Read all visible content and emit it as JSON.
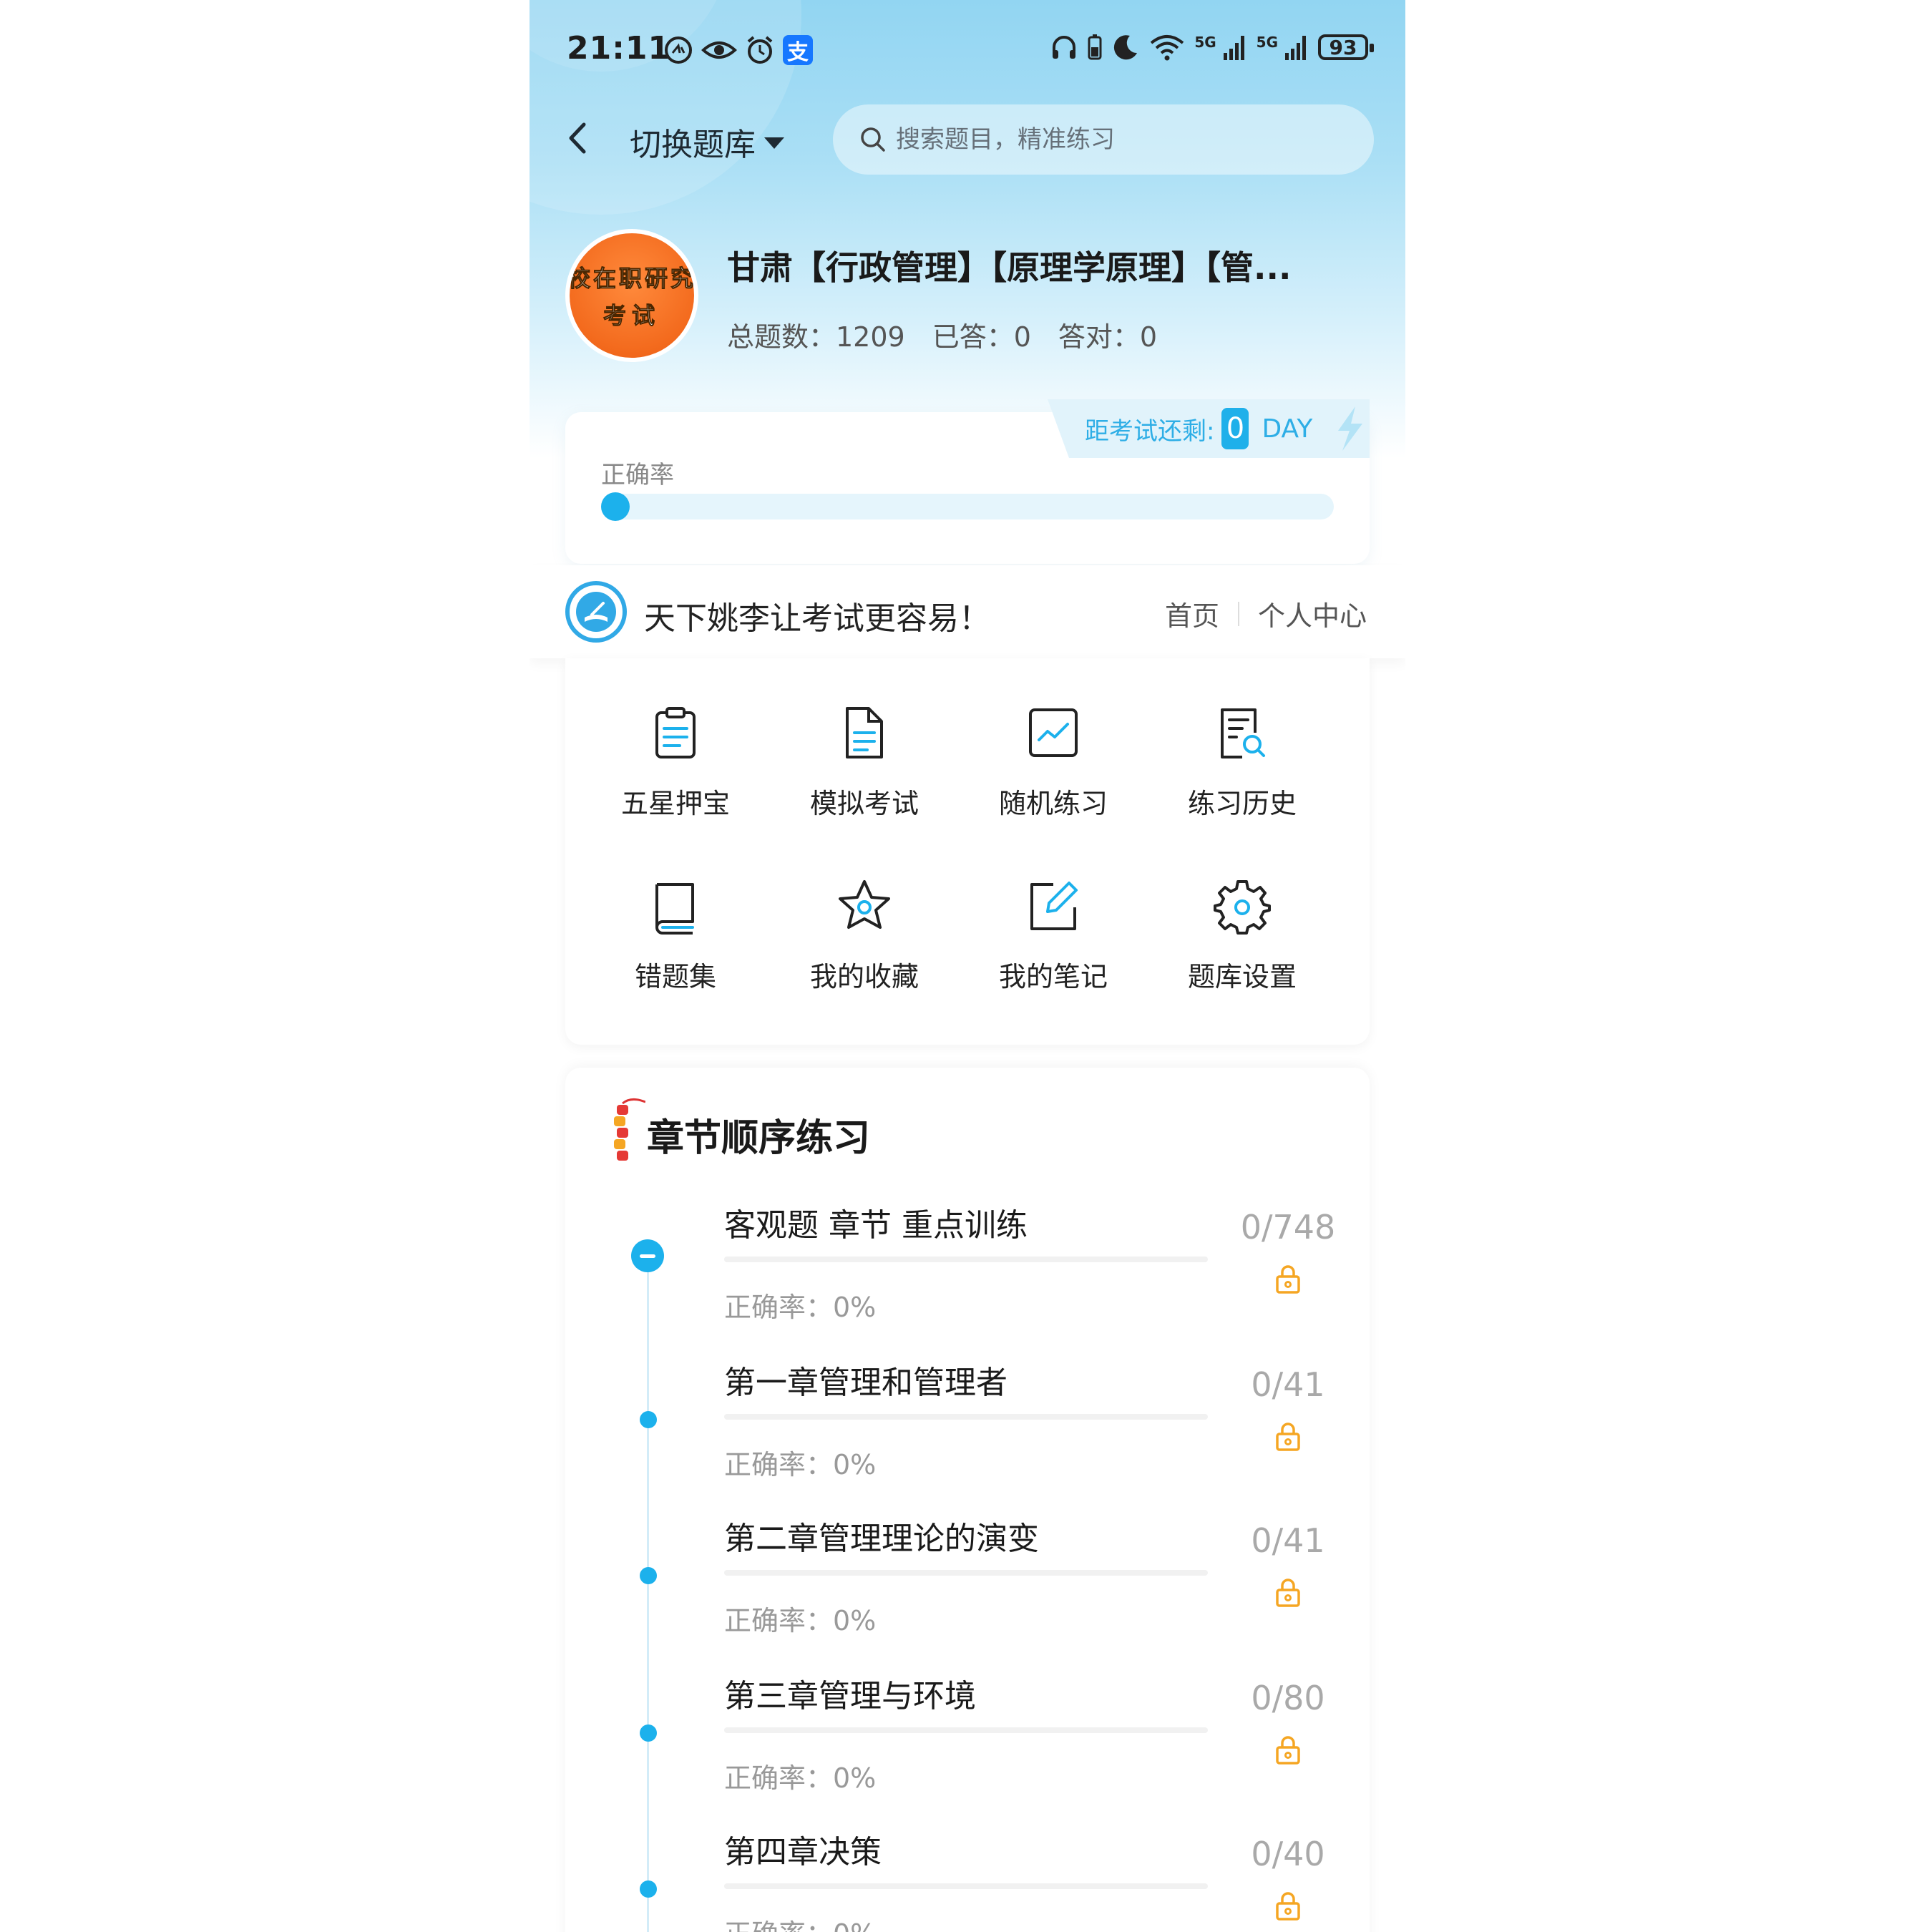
{
  "status_bar": {
    "time": "21:11",
    "battery": "93",
    "net_label": "5G"
  },
  "header": {
    "switch_label": "切换题库",
    "search_placeholder": "搜索题目，精准练习"
  },
  "bank": {
    "avatar_line1": "校在职研究",
    "avatar_line2": "考试",
    "title": "甘肃【行政管理】【原理学原理】【管...",
    "total_label": "总题数：1209",
    "answered_label": "已答：0",
    "correct_label": "答对：0"
  },
  "accuracy": {
    "label": "正确率",
    "value_percent": 0,
    "countdown_label": "距考试还剩:",
    "countdown_days": "0",
    "countdown_unit": "DAY"
  },
  "slogan": {
    "text": "天下姚李让考试更容易！",
    "link_home": "首页",
    "link_profile": "个人中心"
  },
  "menu": [
    {
      "label": "五星押宝",
      "icon": "clipboard-icon"
    },
    {
      "label": "模拟考试",
      "icon": "document-icon"
    },
    {
      "label": "随机练习",
      "icon": "chart-line-icon"
    },
    {
      "label": "练习历史",
      "icon": "history-search-icon"
    },
    {
      "label": "错题集",
      "icon": "book-icon"
    },
    {
      "label": "我的收藏",
      "icon": "star-icon"
    },
    {
      "label": "我的笔记",
      "icon": "edit-note-icon"
    },
    {
      "label": "题库设置",
      "icon": "gear-icon"
    }
  ],
  "chapters": {
    "title": "章节顺序练习",
    "items": [
      {
        "name": "客观题 章节 重点训练",
        "accuracy": "正确率：0%",
        "count": "0/748"
      },
      {
        "name": "第一章管理和管理者",
        "accuracy": "正确率：0%",
        "count": "0/41"
      },
      {
        "name": "第二章管理理论的演变",
        "accuracy": "正确率：0%",
        "count": "0/41"
      },
      {
        "name": "第三章管理与环境",
        "accuracy": "正确率：0%",
        "count": "0/80"
      },
      {
        "name": "第四章决策",
        "accuracy": "正确率：0%",
        "count": "0/40"
      }
    ]
  },
  "colors": {
    "accent": "#1cb1ec",
    "lock": "#f5a623",
    "avatar": "#f36a1d"
  }
}
